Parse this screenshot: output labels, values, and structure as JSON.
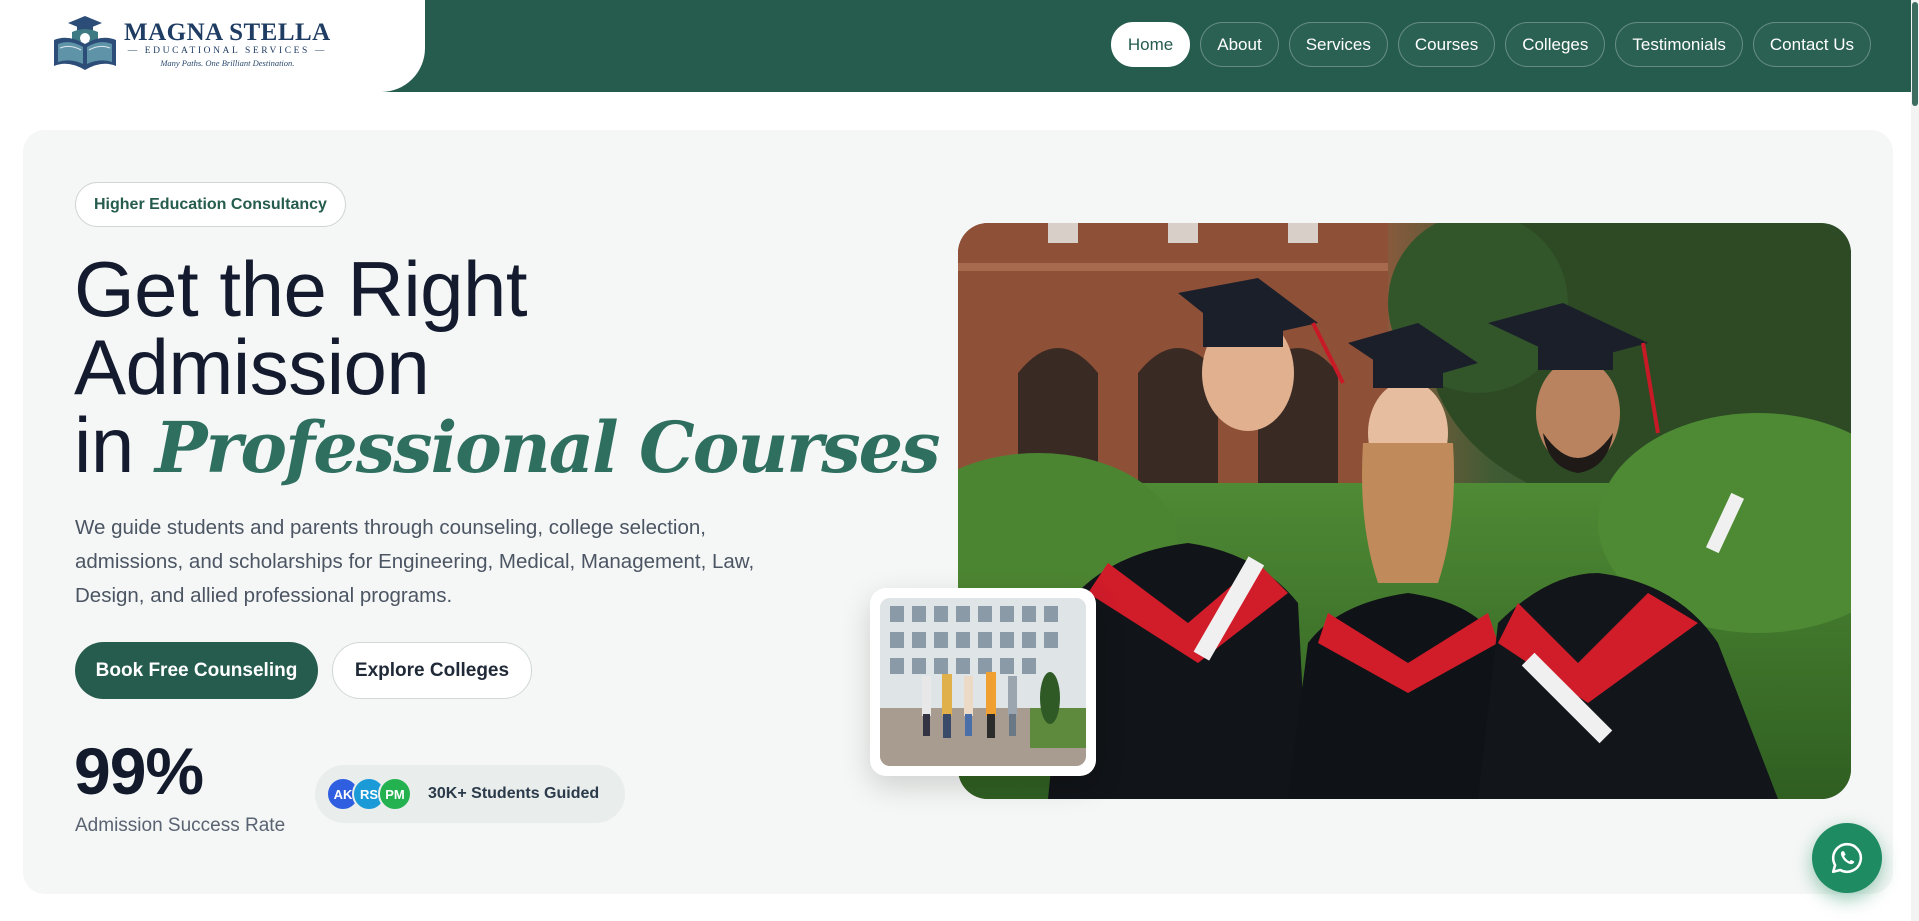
{
  "brand": {
    "title": "MAGNA STELLA",
    "subtitle": "— EDUCATIONAL SERVICES —",
    "tagline": "Many Paths. One Brilliant Destination."
  },
  "nav": {
    "items": [
      {
        "label": "Home",
        "active": true
      },
      {
        "label": "About"
      },
      {
        "label": "Services"
      },
      {
        "label": "Courses"
      },
      {
        "label": "Colleges"
      },
      {
        "label": "Testimonials"
      },
      {
        "label": "Contact Us"
      }
    ]
  },
  "hero": {
    "badge": "Higher Education Consultancy",
    "headline_line1": "Get the Right",
    "headline_line2": "Admission",
    "headline_in": "in ",
    "headline_accent": "Professional Courses",
    "description": "We guide students and parents through counseling, college selection, admissions, and scholarships for Engineering, Medical, Management, Law, Design, and allied professional programs.",
    "primary_cta": "Book Free Counseling",
    "secondary_cta": "Explore Colleges",
    "stat_value": "99%",
    "stat_label": "Admission Success Rate",
    "avatars": [
      {
        "initials": "AK",
        "color": "#2f5fe0"
      },
      {
        "initials": "RS",
        "color": "#1b9ad8"
      },
      {
        "initials": "PM",
        "color": "#23b24f"
      }
    ],
    "students_label": "30K+ Students Guided"
  },
  "icons": {
    "logo": "book-graduation-logo",
    "whatsapp": "whatsapp-icon"
  },
  "colors": {
    "primary": "#255c4e",
    "accent": "#2f6f60",
    "whatsapp": "#1f8b62"
  }
}
